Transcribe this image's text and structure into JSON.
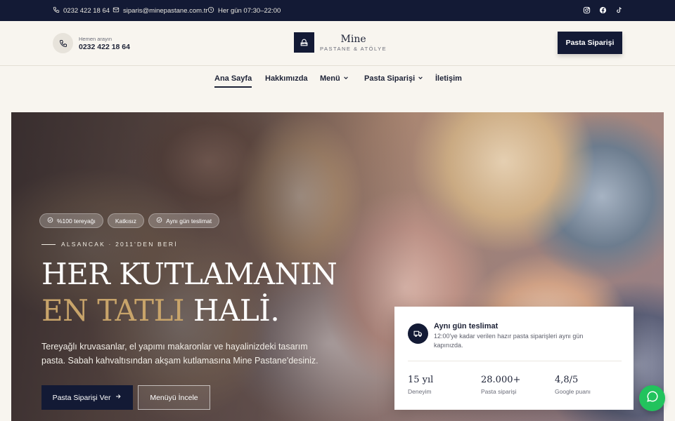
{
  "topbar": {
    "phone": "0232 422 18 64",
    "email": "siparis@minepastane.com.tr",
    "hours": "Her gün 07:30–22:00",
    "socials": [
      "instagram-icon",
      "facebook-icon",
      "tiktok-icon"
    ]
  },
  "header": {
    "call_label": "Hemen arayın",
    "call_number": "0232 422 18 64",
    "logo_title": "Mine",
    "logo_subtitle": "PASTANE & ATÖLYE",
    "order_button": "Pasta Siparişi"
  },
  "nav": {
    "items": [
      {
        "label": "Ana Sayfa",
        "active": true
      },
      {
        "label": "Hakkımızda"
      },
      {
        "label": "Menü",
        "dropdown": true
      },
      {
        "label": "Pasta Siparişi",
        "dropdown": true
      },
      {
        "label": "İletişim"
      }
    ]
  },
  "hero": {
    "badges": [
      "%100 tereyağı",
      "Katkısız",
      "Aynı gün teslimat"
    ],
    "since": "ALSANCAK · 2011'DEN BERİ",
    "title_line1": "HER KUTLAMANIN",
    "title_gold": "EN TATLI",
    "title_rest": "HALİ.",
    "lead": "Tereyağlı kruvasanlar, el yapımı makaronlar ve hayalinizdeki tasarım pasta. Sabah kahvaltısından akşam kutlamasına Mine Pastane'desiniz.",
    "primary_button": "Pasta Siparişi Ver",
    "secondary_button": "Menüyü İncele"
  },
  "card": {
    "title": "Aynı gün teslimat",
    "description": "12:00'ye kadar verilen hazır pasta siparişleri aynı gün kapınızda.",
    "stats": [
      {
        "value": "15 yıl",
        "label": "Deneyim"
      },
      {
        "value": "28.000+",
        "label": "Pasta siparişi"
      },
      {
        "value": "4,8/5",
        "label": "Google puanı"
      }
    ]
  },
  "colors": {
    "navy": "#131a35",
    "gold": "#c8a46a",
    "cream": "#f8f5ef",
    "whatsapp": "#22c35d"
  }
}
